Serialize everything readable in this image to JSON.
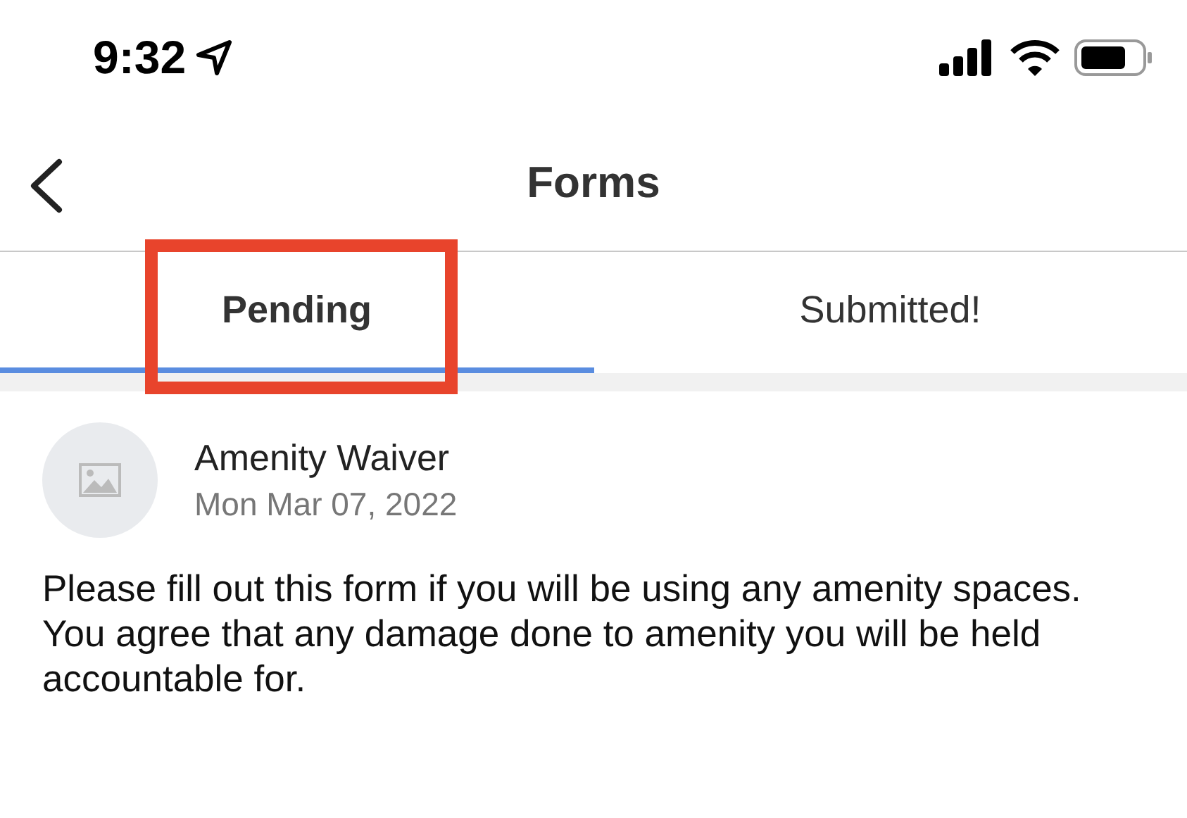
{
  "status_bar": {
    "time": "9:32"
  },
  "nav": {
    "title": "Forms"
  },
  "tabs": [
    {
      "label": "Pending",
      "selected": true,
      "annotated": true
    },
    {
      "label": "Submitted!",
      "selected": false,
      "annotated": false
    }
  ],
  "forms": [
    {
      "name": "Amenity Waiver",
      "date": "Mon Mar 07, 2022",
      "description": "Please fill out this form if you will be using any amenity spaces. You agree that any damage done to amenity you will be held accountable for."
    }
  ]
}
